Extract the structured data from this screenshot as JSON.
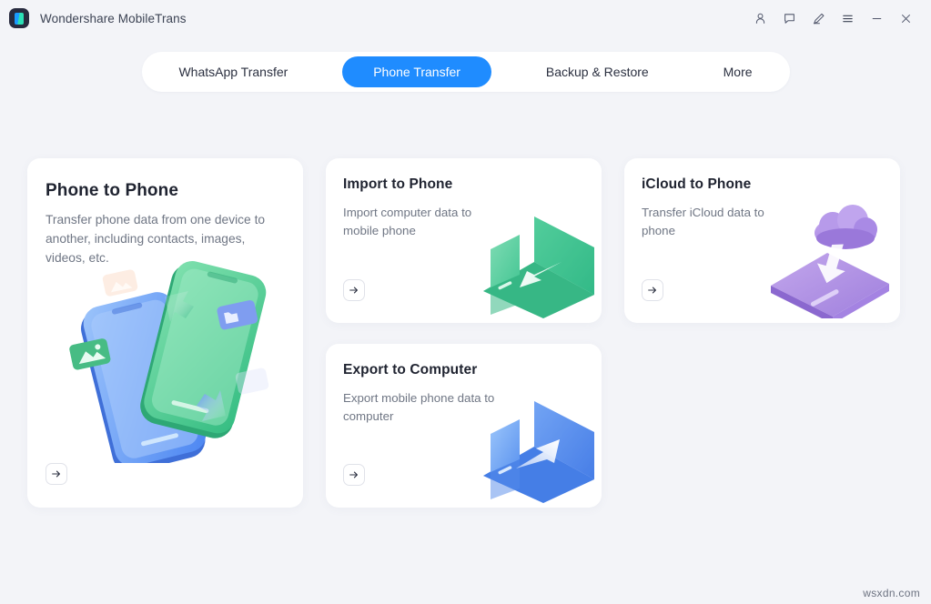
{
  "window": {
    "title": "Wondershare MobileTrans",
    "logo_colors": {
      "bg": "#282b3f",
      "blue": "#1a9bff",
      "green": "#2ce0b6"
    },
    "controls": [
      {
        "name": "account-icon",
        "label": "Account"
      },
      {
        "name": "feedback-icon",
        "label": "Feedback"
      },
      {
        "name": "edit-pen-icon",
        "label": "Edit"
      },
      {
        "name": "menu-icon",
        "label": "Menu"
      },
      {
        "name": "minimize-icon",
        "label": "Minimize"
      },
      {
        "name": "close-icon",
        "label": "Close"
      }
    ]
  },
  "tabs": {
    "active_color": "#1f8cff",
    "items": [
      {
        "label": "WhatsApp Transfer",
        "active": false
      },
      {
        "label": "Phone Transfer",
        "active": true
      },
      {
        "label": "Backup & Restore",
        "active": false
      },
      {
        "label": "More",
        "active": false
      }
    ]
  },
  "cards": {
    "phone_to_phone": {
      "title": "Phone to Phone",
      "description": "Transfer phone data from one device to another, including contacts, images, videos, etc.",
      "action_label": "Go",
      "illustration": "two-phones-transfer",
      "colors": {
        "primary": "#4f8ef7",
        "secondary": "#3ec98a"
      }
    },
    "import_to_phone": {
      "title": "Import to Phone",
      "description": "Import computer data to mobile phone",
      "action_label": "Go",
      "illustration": "laptop-to-phone-green",
      "colors": {
        "primary": "#3fc394"
      }
    },
    "icloud_to_phone": {
      "title": "iCloud to Phone",
      "description": "Transfer iCloud data to phone",
      "action_label": "Go",
      "illustration": "cloud-to-phone-purple",
      "colors": {
        "primary": "#ac8ee0"
      }
    },
    "export_to_computer": {
      "title": "Export to Computer",
      "description": "Export mobile phone data to computer",
      "action_label": "Go",
      "illustration": "phone-to-laptop-blue",
      "colors": {
        "primary": "#5b8ff0"
      }
    }
  },
  "watermark": {
    "text": "wsxdn.com"
  }
}
